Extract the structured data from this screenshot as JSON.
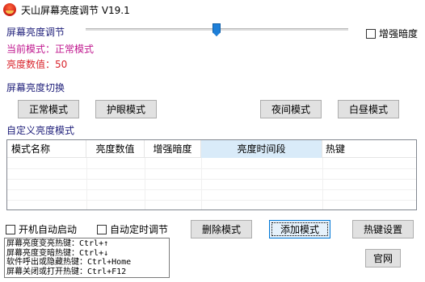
{
  "window": {
    "title": "天山屏幕亮度调节 V19.1"
  },
  "brightness": {
    "section_label": "屏幕亮度调节",
    "slider_level_percent": 50,
    "enhance_dark_label": "增强暗度",
    "mode_line": "当前模式：正常模式",
    "value_line": "亮度数值：50"
  },
  "switch": {
    "section_label": "屏幕亮度切换",
    "buttons": {
      "normal": "正常模式",
      "eye_care": "护眼模式",
      "night": "夜间模式",
      "day": "白昼模式"
    }
  },
  "custom": {
    "section_label": "自定义亮度模式",
    "columns": [
      "模式名称",
      "亮度数值",
      "增强暗度",
      "亮度时间段",
      "热键"
    ],
    "rows": []
  },
  "options": {
    "autostart_label": "开机自动启动",
    "auto_schedule_label": "自动定时调节"
  },
  "actions": {
    "delete_label": "删除模式",
    "add_label": "添加模式",
    "hotkey_settings_label": "热键设置",
    "website_label": "官网"
  },
  "hotkeys_info": [
    "屏幕亮度变亮热键：Ctrl+↑",
    "屏幕亮度变暗热键：Ctrl+↓",
    "软件呼出或隐藏热键：Ctrl+Home",
    "屏幕关闭或打开热键：Ctrl+F12"
  ],
  "colors": {
    "section_label": "#1f1f7a",
    "mode_text": "#c0188f",
    "value_text": "#d8222a",
    "slider_thumb": "#1e7fd8",
    "selected_header": "#d9ebf9"
  }
}
